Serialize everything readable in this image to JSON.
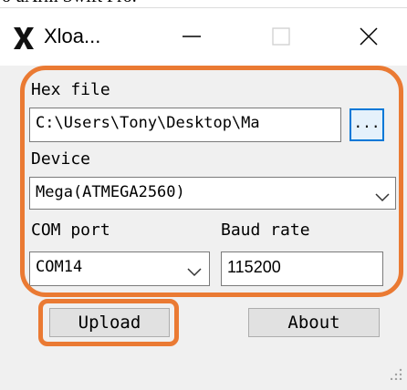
{
  "page_top_text": "o uArm Swift Pro.",
  "window": {
    "title": "Xloa...",
    "icon": "x-logo-icon"
  },
  "controls": {
    "minimize_icon": "minimize-icon",
    "maximize_icon": "maximize-icon",
    "close_icon": "close-icon"
  },
  "form": {
    "hex_file_label": "Hex file",
    "hex_file_value": "C:\\Users\\Tony\\Desktop\\Ma",
    "browse_label": "...",
    "device_label": "Device",
    "device_value": "Mega(ATMEGA2560)",
    "com_port_label": "COM port",
    "com_port_value": "COM14",
    "baud_rate_label": "Baud rate",
    "baud_rate_value": "115200"
  },
  "buttons": {
    "upload": "Upload",
    "about": "About"
  },
  "colors": {
    "annotation": "#ea7a33",
    "focus_border": "#0078d7",
    "window_bg": "#f0f0f0"
  }
}
